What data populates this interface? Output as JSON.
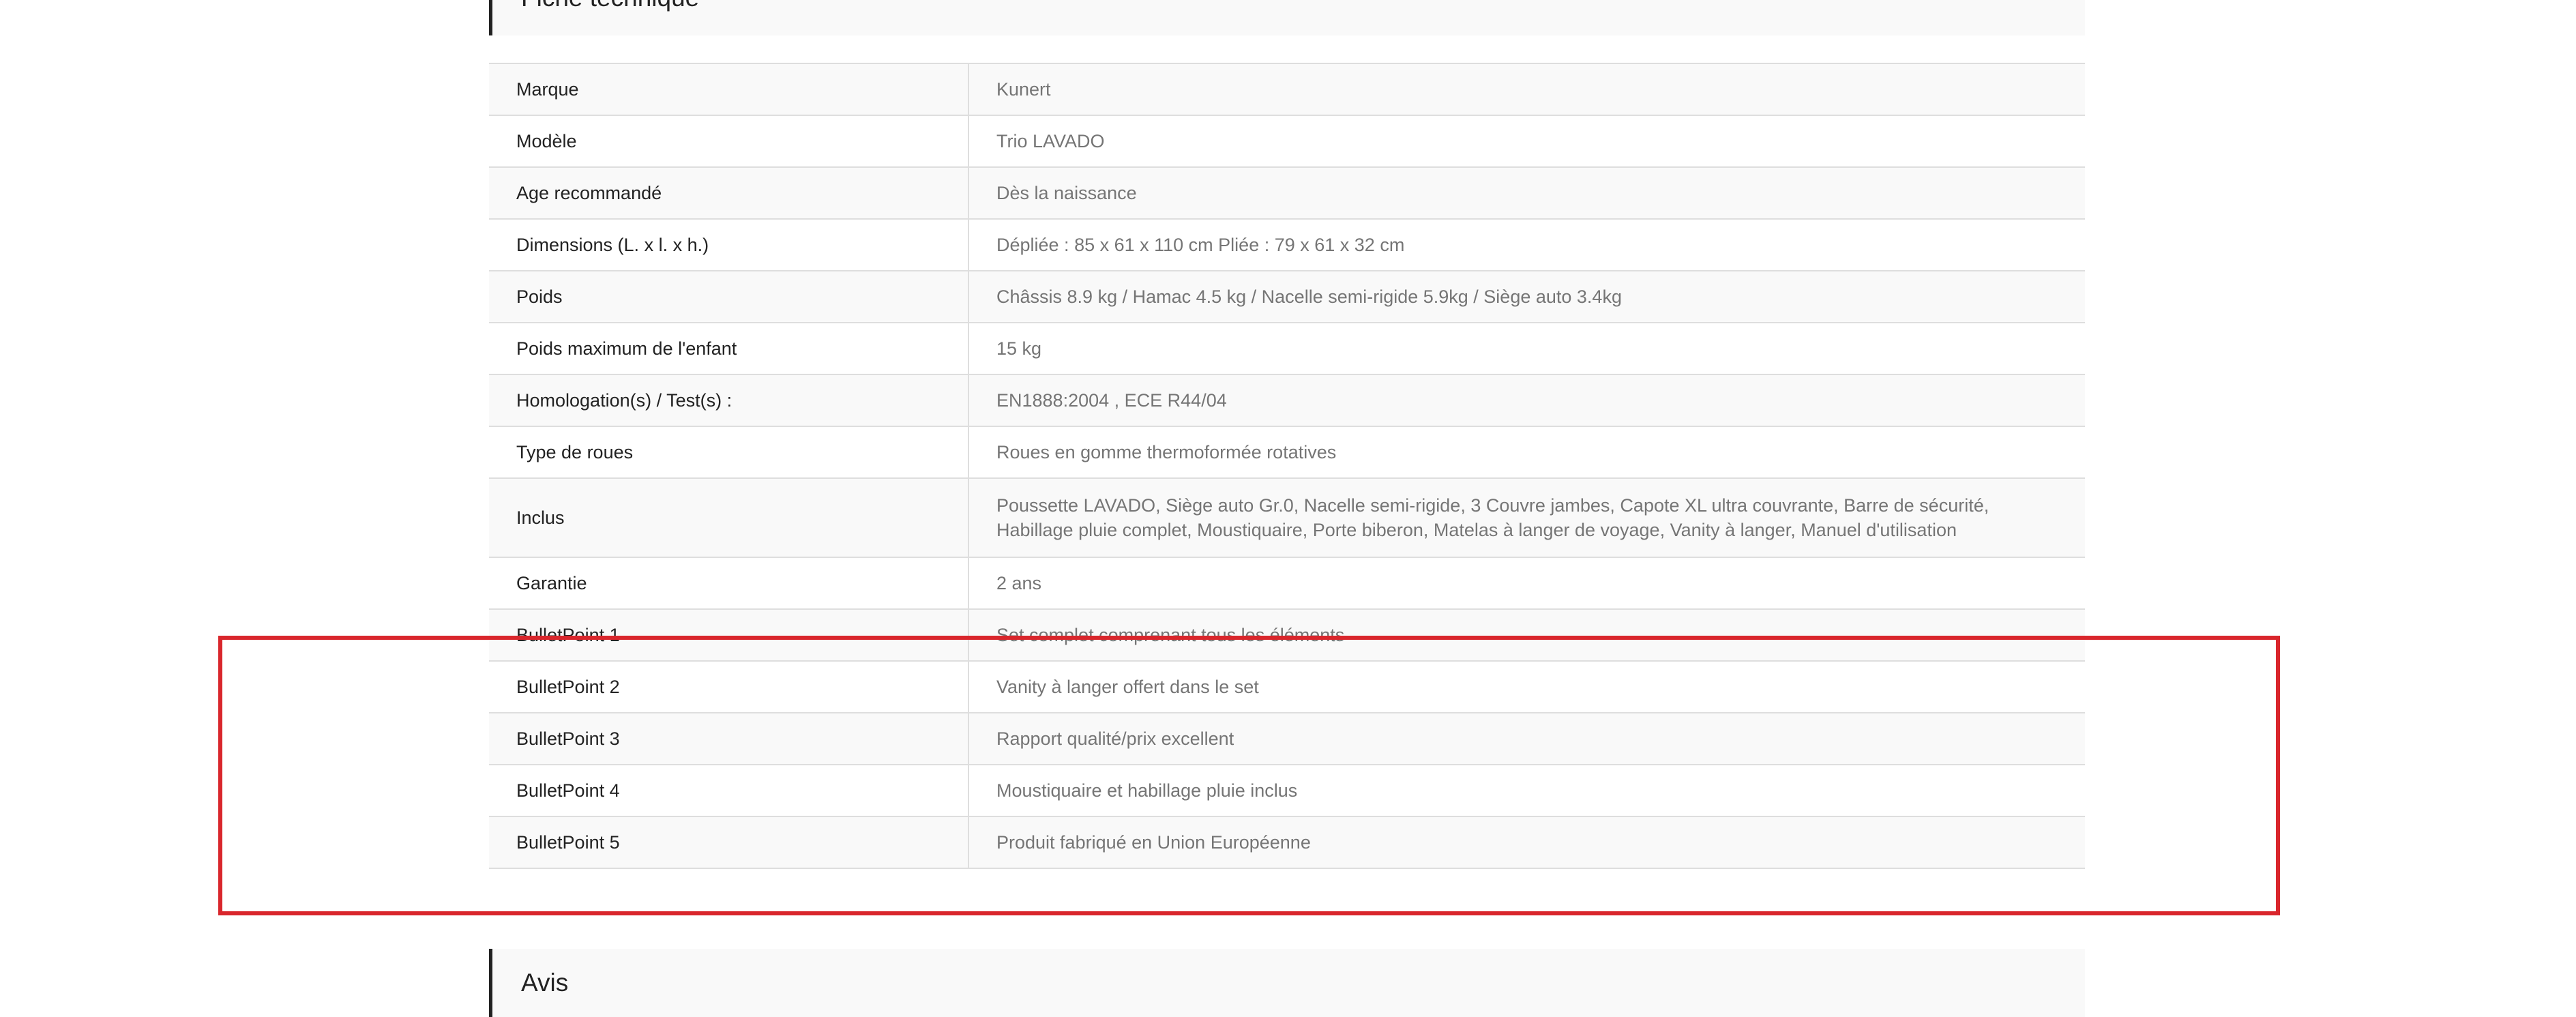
{
  "colors": {
    "accent_box": "#d9262c",
    "label_text": "#222222",
    "value_text": "#757575",
    "row_stripe": "#f9f9f9",
    "divider": "#dedede"
  },
  "header_top": {
    "title": "Fiche technique"
  },
  "spec_table": {
    "rows": [
      {
        "label": "Marque",
        "value": "Kunert"
      },
      {
        "label": "Modèle",
        "value": "Trio LAVADO"
      },
      {
        "label": "Age recommandé",
        "value": "Dès la naissance"
      },
      {
        "label": "Dimensions (L. x l. x h.)",
        "value": "Dépliée : 85 x 61 x 110 cm Pliée : 79 x 61 x 32 cm"
      },
      {
        "label": "Poids",
        "value": "Châssis 8.9 kg / Hamac 4.5 kg / Nacelle semi-rigide 5.9kg / Siège auto 3.4kg"
      },
      {
        "label": "Poids maximum de l'enfant",
        "value": "15 kg"
      },
      {
        "label": "Homologation(s) / Test(s) :",
        "value": "EN1888:2004 , ECE R44/04"
      },
      {
        "label": "Type de roues",
        "value": "Roues en gomme thermoformée rotatives"
      },
      {
        "label": "Inclus",
        "value": "Poussette LAVADO, Siège auto Gr.0, Nacelle semi-rigide, 3 Couvre jambes, Capote XL ultra couvrante, Barre de sécurité, Habillage pluie complet, Moustiquaire, Porte biberon, Matelas à langer de voyage, Vanity à langer, Manuel d'utilisation"
      },
      {
        "label": "Garantie",
        "value": "2 ans"
      },
      {
        "label": "BulletPoint 1",
        "value": "Set complet comprenant tous les éléments"
      },
      {
        "label": "BulletPoint 2",
        "value": "Vanity à langer offert dans le set"
      },
      {
        "label": "BulletPoint 3",
        "value": "Rapport qualité/prix excellent"
      },
      {
        "label": "BulletPoint 4",
        "value": "Moustiquaire et habillage pluie inclus"
      },
      {
        "label": "BulletPoint 5",
        "value": "Produit fabriqué en Union Européenne"
      }
    ]
  },
  "header_bottom": {
    "title": "Avis"
  }
}
